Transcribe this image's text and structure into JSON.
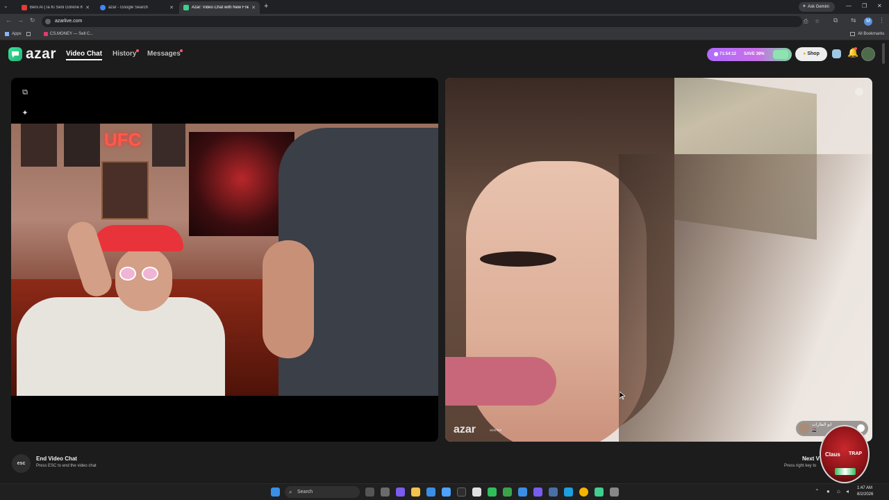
{
  "browser": {
    "tabs": [
      {
        "title": "Beni Al (Ta Ki Seni Görene Kada…",
        "favicon_color": "#e53935"
      },
      {
        "title": "azar - Google Search",
        "favicon_color": "#4285f4"
      },
      {
        "title": "Azar: Video Chat with New Frie…",
        "favicon_color": "#3fcf8e"
      }
    ],
    "new_tab": "+",
    "ask_gemini": "Ask Gemini",
    "url": "azarlive.com",
    "profile_initial": "M",
    "bookmarks": {
      "apps": "Apps",
      "csmoney": "CS.MONEY — Sell C...",
      "all": "All Bookmarks"
    }
  },
  "app": {
    "logo": "azar",
    "nav": {
      "video_chat": "Video Chat",
      "history": "History",
      "messages": "Messages"
    },
    "promo": {
      "timer": "71:54:12",
      "save": "SAVE 38%"
    },
    "shop": "Shop",
    "accent": "#38e29a"
  },
  "partner": {
    "watermark": "azar",
    "watermark_sub": "azarlive",
    "name_tag": "ابو الطارات",
    "name_sub": "🇮🇶"
  },
  "footer": {
    "esc_key": "esc",
    "end_title": "End Video Chat",
    "end_hint": "Press ESC to end the video chat",
    "next_title": "Next V",
    "next_hint": "Press right key to"
  },
  "streamer_badge": {
    "line1": "Claus",
    "line2": "TRAP"
  },
  "taskbar": {
    "search": "Search",
    "time": "1:47 AM",
    "date": "8/2/2026"
  }
}
